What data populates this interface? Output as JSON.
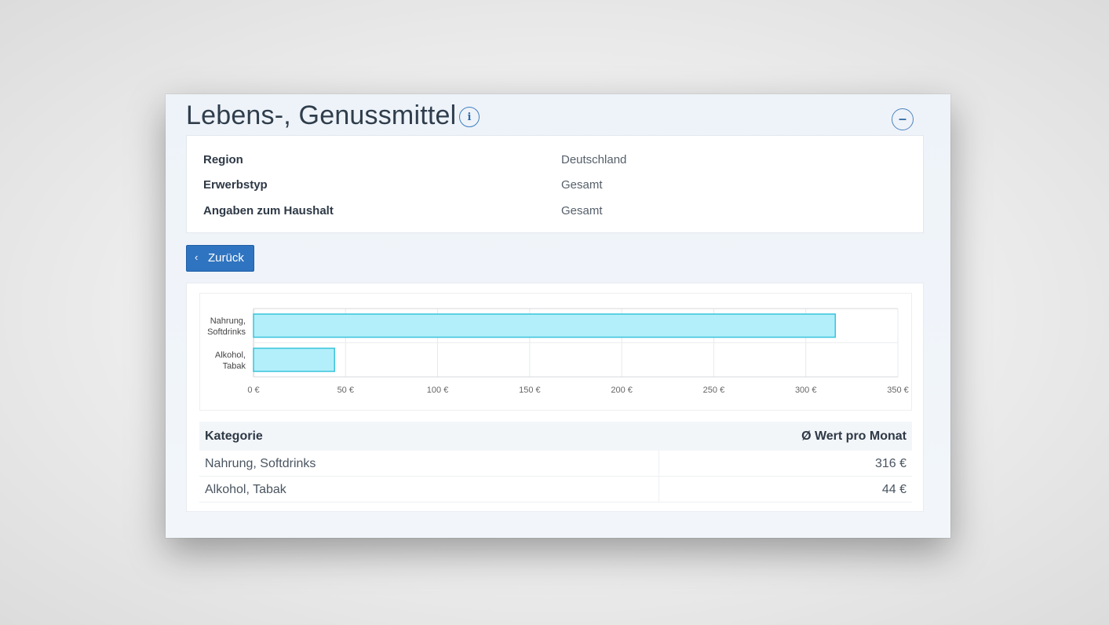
{
  "header": {
    "title": "Lebens-, Genussmittel",
    "info_icon": "info-icon",
    "collapse_symbol": "–"
  },
  "meta": [
    {
      "label": "Region",
      "value": "Deutschland"
    },
    {
      "label": "Erwerbstyp",
      "value": "Gesamt"
    },
    {
      "label": "Angaben zum Haushalt",
      "value": "Gesamt"
    }
  ],
  "back_button": {
    "label": "Zurück",
    "icon": "chevron-left-icon"
  },
  "chart_data": {
    "type": "bar",
    "orientation": "horizontal",
    "categories": [
      "Nahrung, Softdrinks",
      "Alkohol, Tabak"
    ],
    "category_labels": [
      [
        "Nahrung,",
        "Softdrinks"
      ],
      [
        "Alkohol,",
        "Tabak"
      ]
    ],
    "values": [
      316,
      44
    ],
    "xlim": [
      0,
      350
    ],
    "ticks": [
      0,
      50,
      100,
      150,
      200,
      250,
      300,
      350
    ],
    "tick_labels": [
      "0 €",
      "50 €",
      "100 €",
      "150 €",
      "200 €",
      "250 €",
      "300 €",
      "350 €"
    ],
    "bar_color": "#b3effa",
    "bar_border": "#39c4dc",
    "grid": true
  },
  "table": {
    "headers": [
      "Kategorie",
      "Ø Wert pro Monat"
    ],
    "rows": [
      {
        "kategorie": "Nahrung, Softdrinks",
        "wert": "316 €"
      },
      {
        "kategorie": "Alkohol, Tabak",
        "wert": "44 €"
      }
    ]
  }
}
